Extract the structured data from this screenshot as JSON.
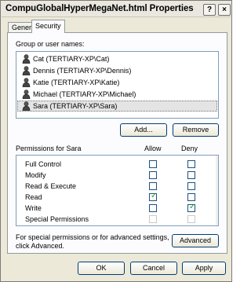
{
  "window": {
    "title": "CompuGlobalHyperMegaNet.html Properties",
    "help_button": "?",
    "close_button": "×"
  },
  "tabs": [
    {
      "label": "General",
      "active": false
    },
    {
      "label": "Security",
      "active": true
    }
  ],
  "security": {
    "group_label": "Group or user names:",
    "users": [
      {
        "name": "Cat (TERTIARY-XP\\Cat)",
        "selected": false
      },
      {
        "name": "Dennis (TERTIARY-XP\\Dennis)",
        "selected": false
      },
      {
        "name": "Katie (TERTIARY-XP\\Katie)",
        "selected": false
      },
      {
        "name": "Michael (TERTIARY-XP\\Michael)",
        "selected": false
      },
      {
        "name": "Sara (TERTIARY-XP\\Sara)",
        "selected": true
      }
    ],
    "add_button": "Add...",
    "remove_button": "Remove",
    "permissions_for": "Permissions for Sara",
    "allow_header": "Allow",
    "deny_header": "Deny",
    "permissions": [
      {
        "name": "Full Control",
        "allow": false,
        "deny": false,
        "allow_disabled": false,
        "deny_disabled": false
      },
      {
        "name": "Modify",
        "allow": false,
        "deny": false,
        "allow_disabled": false,
        "deny_disabled": false
      },
      {
        "name": "Read & Execute",
        "allow": false,
        "deny": false,
        "allow_disabled": false,
        "deny_disabled": false
      },
      {
        "name": "Read",
        "allow": true,
        "deny": false,
        "allow_disabled": false,
        "deny_disabled": false
      },
      {
        "name": "Write",
        "allow": false,
        "deny": true,
        "allow_disabled": false,
        "deny_disabled": false
      },
      {
        "name": "Special Permissions",
        "allow": false,
        "deny": false,
        "allow_disabled": true,
        "deny_disabled": true
      }
    ],
    "advanced_text_line1": "For special permissions or for advanced settings,",
    "advanced_text_line2": "click Advanced.",
    "advanced_button": "Advanced"
  },
  "footer": {
    "ok_button": "OK",
    "cancel_button": "Cancel",
    "apply_button": "Apply"
  },
  "icons": {
    "user": "user-icon",
    "check": "✓"
  }
}
